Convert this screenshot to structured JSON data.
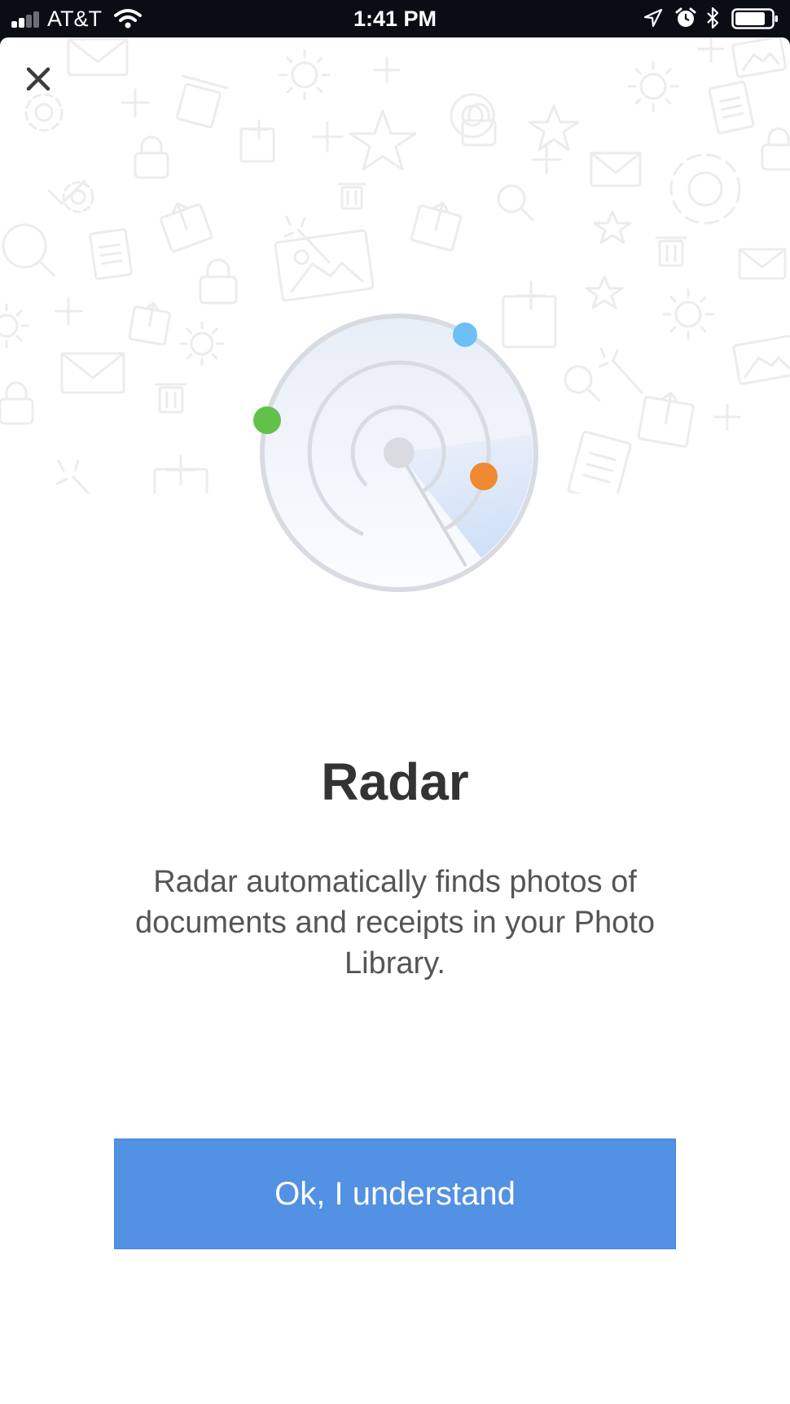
{
  "status_bar": {
    "carrier": "AT&T",
    "time": "1:41 PM"
  },
  "icons": {
    "close": "close-icon",
    "signal": "cellular-signal-icon",
    "wifi": "wifi-icon",
    "location": "location-arrow-icon",
    "alarm": "alarm-clock-icon",
    "bluetooth": "bluetooth-icon",
    "battery": "battery-icon",
    "illustration": "radar-illustration"
  },
  "content": {
    "title": "Radar",
    "description": "Radar automatically finds photos of documents and receipts in your Photo Library.",
    "button_label": "Ok, I understand"
  },
  "colors": {
    "button": "#5291e3",
    "radar_dot_blue": "#6cc0f5",
    "radar_dot_green": "#62c14a",
    "radar_dot_orange": "#ef8a32"
  }
}
